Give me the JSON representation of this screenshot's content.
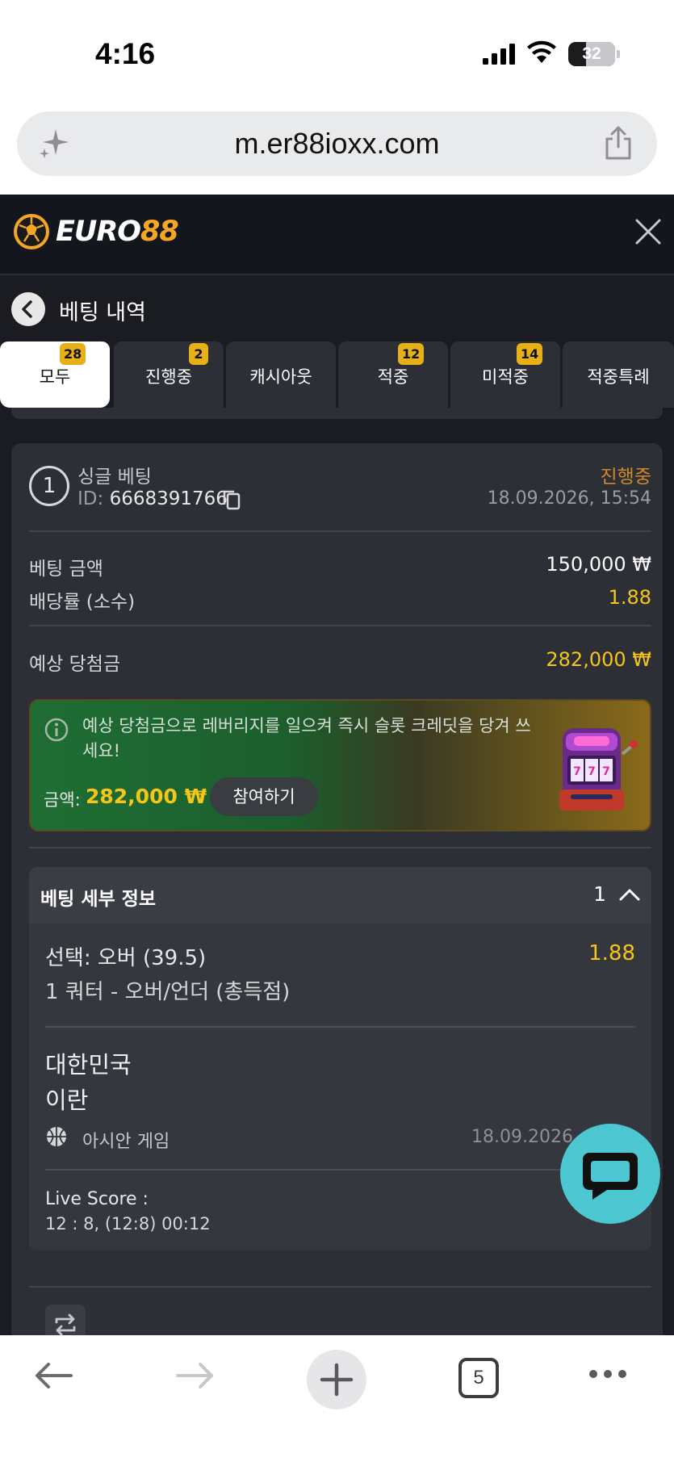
{
  "status_bar": {
    "time": "4:16",
    "battery": "32"
  },
  "browser": {
    "url": "m.er88ioxx.com",
    "tab_count": "5"
  },
  "header": {
    "brand_white": "EURO",
    "brand_gold": "88"
  },
  "page": {
    "title": "베팅 내역"
  },
  "tabs": [
    {
      "label": "모두",
      "badge": "28",
      "active": true
    },
    {
      "label": "진행중",
      "badge": "2"
    },
    {
      "label": "캐시아웃",
      "badge": ""
    },
    {
      "label": "적중",
      "badge": "12"
    },
    {
      "label": "미적중",
      "badge": "14"
    },
    {
      "label": "적중특례",
      "badge": ""
    }
  ],
  "bet": {
    "number": "1",
    "type": "싱글 베팅",
    "id_prefix": "ID:",
    "id": "6668391766",
    "status": "진행중",
    "date": "18.09.2026, 15:54",
    "stake_label": "베팅 금액",
    "stake": "150,000 ₩",
    "odds_label": "배당률 (소수)",
    "odds": "1.88",
    "payout_label": "예상 당첨금",
    "payout": "282,000 ₩"
  },
  "promo": {
    "message": "예상 당첨금으로 레버리지를 일으켜 즉시 슬롯 크레딧을 당겨 쓰세요!",
    "amount_label": "금액:",
    "amount": "282,000 ₩",
    "button": "참여하기"
  },
  "details": {
    "title": "베팅 세부 정보",
    "count": "1",
    "selection": "선택: 오버 (39.5)",
    "selection_odds": "1.88",
    "market": "1 쿼터 - 오버/언더 (총득점)",
    "team_home": "대한민국",
    "team_away": "이란",
    "league": "아시안 게임",
    "event_date": "18.09.2026, 1",
    "live_label": "Live Score :",
    "live_score": "12 : 8, (12:8) 00:12"
  },
  "colors": {
    "accent_gold": "#f5c518",
    "status_orange": "#d08a27",
    "chat": "#4cc6d1",
    "badge": "#e8b017"
  }
}
